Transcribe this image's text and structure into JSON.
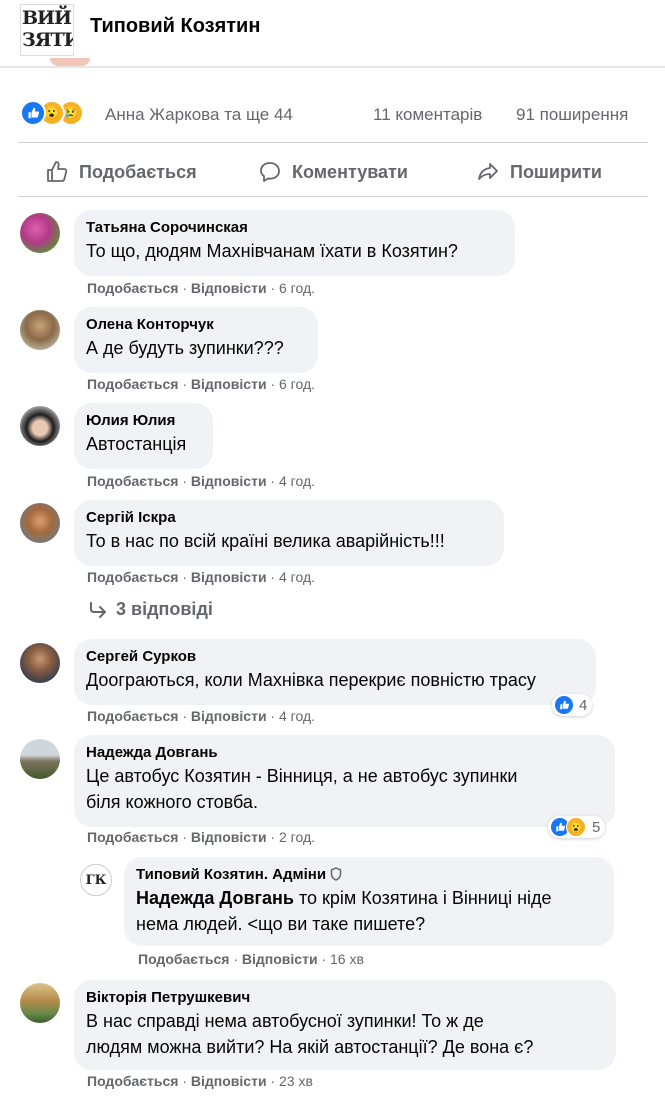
{
  "header": {
    "logo_line1": "ВИЙ",
    "logo_line2": "ЗЯТИ",
    "page_name": "Типовий Козятин"
  },
  "post_stats": {
    "reactors": "Анна Жаркова та ще 44",
    "comments": "11 коментарів",
    "shares": "91 поширення",
    "reaction_icons": [
      "like-icon",
      "wow-icon",
      "sad-icon"
    ]
  },
  "actions": {
    "like": "Подобається",
    "comment": "Коментувати",
    "share": "Поширити"
  },
  "colors": {
    "like_blue": "#1877f2",
    "reaction_yellow": "#f7b125",
    "meta_gray": "#65676b",
    "bubble_bg": "#f0f2f5"
  },
  "comments": [
    {
      "author": "Татьяна Сорочинская",
      "text": "То що, дюдям Махнівчанам їхати в Козятин?",
      "like": "Подобається",
      "reply": "Відповісти",
      "time": "6 год."
    },
    {
      "author": "Олена Конторчук",
      "text": "А де будуть зупинки???",
      "like": "Подобається",
      "reply": "Відповісти",
      "time": "6 год."
    },
    {
      "author": "Юлия Юлия",
      "text": "Автостанція",
      "like": "Подобається",
      "reply": "Відповісти",
      "time": "4 год."
    },
    {
      "author": "Сергій Іскра",
      "text": "То в нас по всій країні велика аварійність!!!",
      "like": "Подобається",
      "reply": "Відповісти",
      "time": "4 год."
    },
    {
      "author": "Сергей Сурков",
      "text": "Доограються, коли Махнівка перекриє повністю трасу",
      "like": "Подобається",
      "reply": "Відповісти",
      "time": "4 год.",
      "reaction_count": "4"
    },
    {
      "author": "Надежда Довгань",
      "text_line1": "Це автобус Козятин - Вінниця, а не автобус зупинки",
      "text_line2": "біля кожного стовба.",
      "like": "Подобається",
      "reply": "Відповісти",
      "time": "2 год.",
      "reaction_count": "5"
    },
    {
      "author": "Вікторія Петрушкевич",
      "text_line1": "В нас справді нема автобусної зупинки! То ж де",
      "text_line2": "людям можна вийти? На якій автостанції? Де вона є?",
      "like": "Подобається",
      "reply": "Відповісти",
      "time": "23 хв"
    }
  ],
  "replies_link": "3 відповіді",
  "admin_reply": {
    "author": "Типовий Козятин. Адміни",
    "avatar_text": "ГК",
    "mention": "Надежда Довгань",
    "text_line1_rest": " то крім Козятина і Вінниці ніде",
    "text_line2": "нема людей. <що ви таке пишете?",
    "like": "Подобається",
    "reply": "Відповісти",
    "time": "16 хв"
  }
}
